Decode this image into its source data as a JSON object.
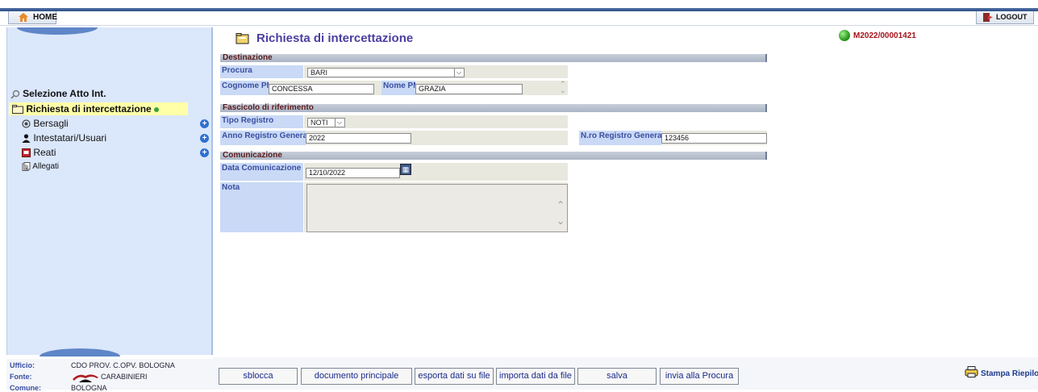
{
  "topbar": {
    "home_label": "HOME",
    "logout_label": "LOGOUT"
  },
  "sidebar": {
    "section_title": "Selezione Atto Int.",
    "active_item": "Richiesta di intercettazione",
    "items": [
      {
        "label": "Bersagli",
        "icon": "target-icon",
        "has_add": true
      },
      {
        "label": "Intestatari/Usuari",
        "icon": "person-icon",
        "has_add": true
      },
      {
        "label": "Reati",
        "icon": "book-icon",
        "has_add": true
      },
      {
        "label": "Allegati",
        "icon": "attachment-icon",
        "has_add": false
      }
    ]
  },
  "footer_info": {
    "ufficio_label": "Ufficio:",
    "ufficio_value": "CDO PROV. C.OPV. BOLOGNA",
    "fonte_label": "Fonte:",
    "fonte_value": "CARABINIERI",
    "comune_label": "Comune:",
    "comune_value": "BOLOGNA"
  },
  "page": {
    "title": "Richiesta di intercettazione",
    "case_id": "M2022/00001421"
  },
  "destinazione": {
    "header": "Destinazione",
    "procura_label": "Procura",
    "procura_value": "BARI",
    "cognome_label": "Cognome PM",
    "cognome_value": "CONCESSA",
    "nome_label": "Nome PM",
    "nome_value": "GRAZIA"
  },
  "fascicolo": {
    "header": "Fascicolo di riferimento",
    "tipo_label": "Tipo Registro",
    "tipo_value": "NOTI",
    "anno_label": "Anno Registro Generale",
    "anno_value": "2022",
    "nro_label": "N.ro Registro Generale",
    "nro_value": "123456"
  },
  "comunicazione": {
    "header": "Comunicazione",
    "data_label": "Data Comunicazione",
    "data_value": "12/10/2022",
    "nota_label": "Nota",
    "nota_value": ""
  },
  "buttons": {
    "sblocca": "sblocca",
    "documento": "documento principale",
    "esporta": "esporta dati su file",
    "importa": "importa dati da file",
    "salva": "salva",
    "invia": "invia alla Procura",
    "stampa": "Stampa Riepilogo"
  }
}
